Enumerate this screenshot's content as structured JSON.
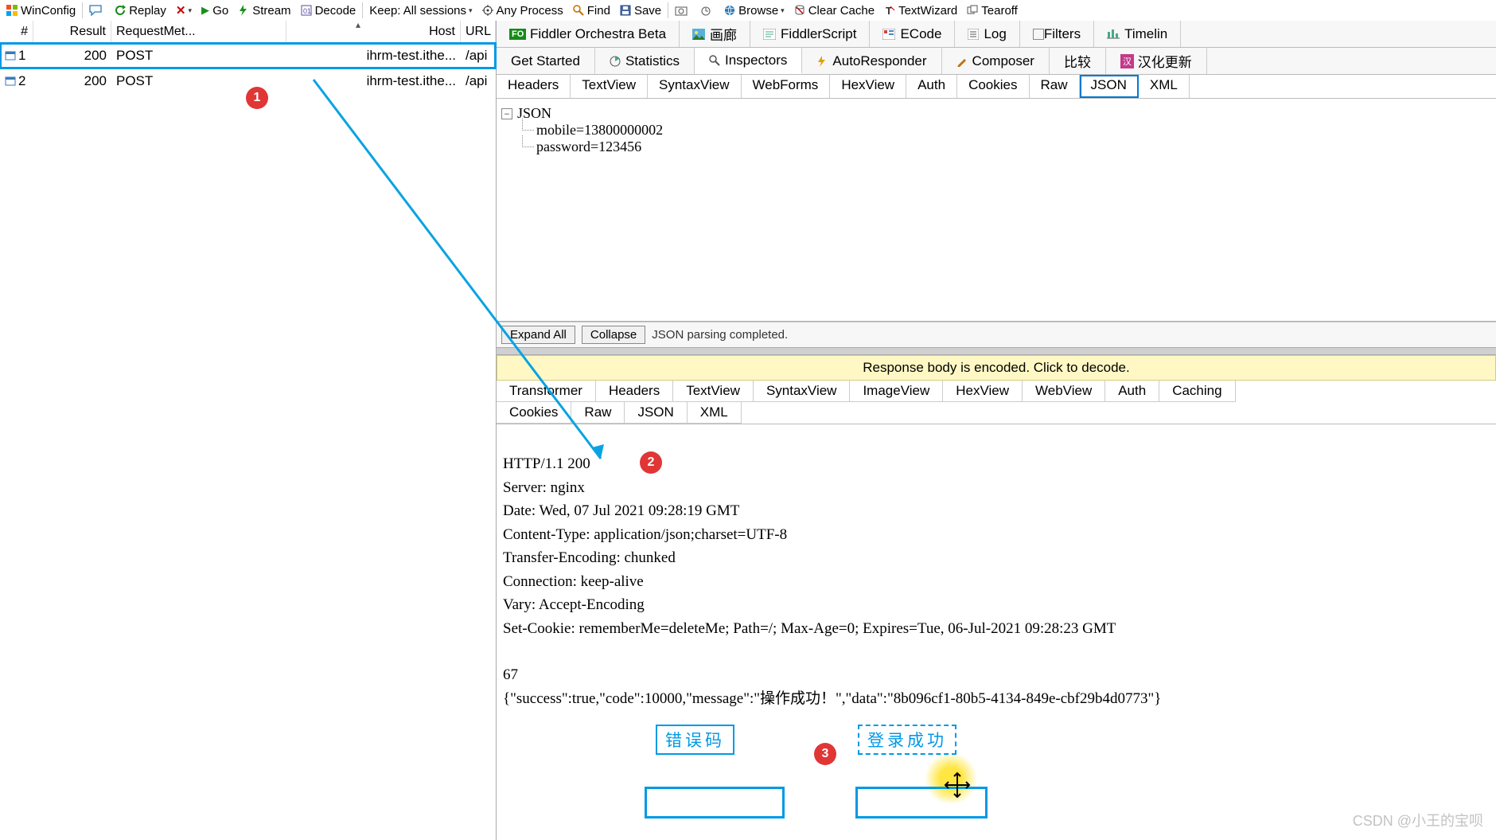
{
  "toolbar": {
    "winconfig": "WinConfig",
    "replay": "Replay",
    "go": "Go",
    "stream": "Stream",
    "decode": "Decode",
    "keep": "Keep: All sessions",
    "anyprocess": "Any Process",
    "find": "Find",
    "save": "Save",
    "browse": "Browse",
    "clearcache": "Clear Cache",
    "textwizard": "TextWizard",
    "tearoff": "Tearoff"
  },
  "session_cols": {
    "num": "#",
    "result": "Result",
    "method": "RequestMet...",
    "host": "Host",
    "url": "URL"
  },
  "sessions": [
    {
      "num": "1",
      "result": "200",
      "method": "POST",
      "host": "ihrm-test.ithe...",
      "url": "/api"
    },
    {
      "num": "2",
      "result": "200",
      "method": "POST",
      "host": "ihrm-test.ithe...",
      "url": "/api"
    }
  ],
  "tabs1": {
    "orchestra": "Fiddler Orchestra Beta",
    "gallery": "画廊",
    "script": "FiddlerScript",
    "ecode": "ECode",
    "log": "Log",
    "filters": "Filters",
    "timeline": "Timelin"
  },
  "tabs2": {
    "getstarted": "Get Started",
    "statistics": "Statistics",
    "inspectors": "Inspectors",
    "autoresponder": "AutoResponder",
    "composer": "Composer",
    "compare": "比较",
    "hanhua": "汉化更新"
  },
  "req_tabs": [
    "Headers",
    "TextView",
    "SyntaxView",
    "WebForms",
    "HexView",
    "Auth",
    "Cookies",
    "Raw",
    "JSON",
    "XML"
  ],
  "req_json": {
    "root": "JSON",
    "mobile": "mobile=13800000002",
    "password": "password=123456"
  },
  "req_footer": {
    "expand": "Expand All",
    "collapse": "Collapse",
    "status": "JSON parsing completed."
  },
  "decode_banner": "Response body is encoded. Click to decode.",
  "resp_tabs_row1": [
    "Transformer",
    "Headers",
    "TextView",
    "SyntaxView",
    "ImageView",
    "HexView",
    "WebView",
    "Auth",
    "Caching"
  ],
  "resp_tabs_row2": [
    "Cookies",
    "Raw",
    "JSON",
    "XML"
  ],
  "resp_body": {
    "l1": "HTTP/1.1 200",
    "l2": "Server: nginx",
    "l3": "Date: Wed, 07 Jul 2021 09:28:19 GMT",
    "l4": "Content-Type: application/json;charset=UTF-8",
    "l5": "Transfer-Encoding: chunked",
    "l6": "Connection: keep-alive",
    "l7": "Vary: Accept-Encoding",
    "l8": "Set-Cookie: rememberMe=deleteMe; Path=/; Max-Age=0; Expires=Tue, 06-Jul-2021 09:28:23 GMT",
    "blank": "",
    "l9": "67",
    "l10": "{\"success\":true,\"code\":10000,\"message\":\"操作成功！\",\"data\":\"8b096cf1-80b5-4134-849e-cbf29b4d0773\"}"
  },
  "annotations": {
    "badge1": "1",
    "badge2": "2",
    "badge3": "3",
    "errcode": "错误码",
    "loginok": "登录成功"
  },
  "watermark": "CSDN @小王的宝呗"
}
